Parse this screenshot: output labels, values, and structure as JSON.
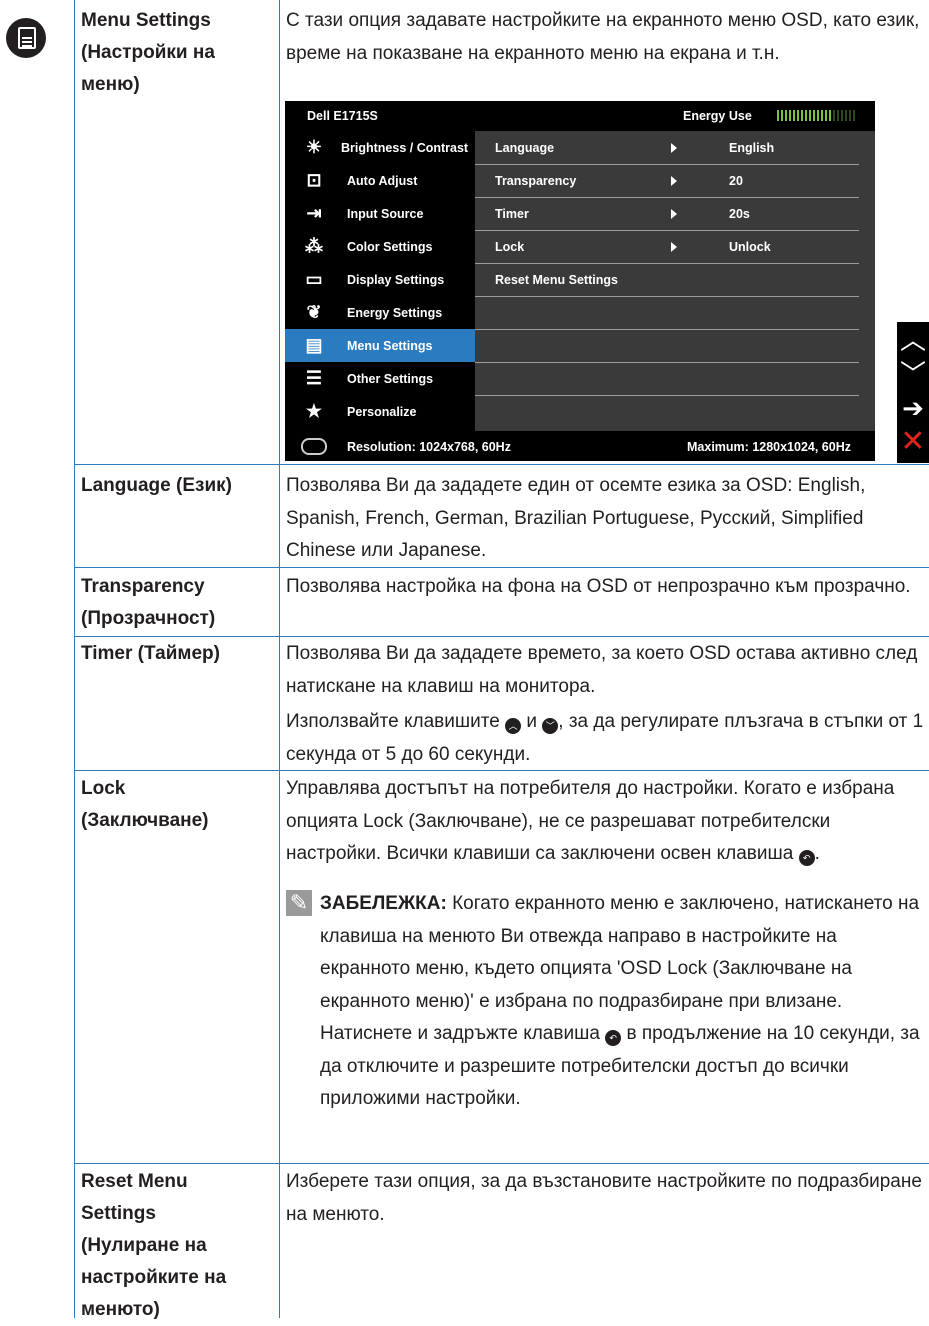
{
  "rows": {
    "menu_settings": {
      "label": "Menu Settings (Настройки на меню)",
      "desc": "С тази опция задавате настройките на екранното меню OSD, като език, време на показване на екранното меню на екрана и т.н."
    },
    "language": {
      "label": "Language (Език)",
      "desc": "Позволява Ви да зададете един от осемте езика за OSD: English, Spanish, French, German, Brazilian Portuguese, Русский, Simplified Chinese или Japanese."
    },
    "transparency": {
      "label": "Transparency (Прозрачност)",
      "desc": "Позволява настройка на фона на OSD от непрозрачно към прозрачно."
    },
    "timer": {
      "label": "Timer (Таймер)",
      "desc1": "Позволява Ви да зададете времето, за което OSD остава активно след натискане на клавиш на монитора.",
      "desc2_a": "Използвайте клавишите",
      "desc2_b": "и",
      "desc2_c": ", за да регулирате плъзгача в стъпки от 1 секунда от 5 до 60 секунди."
    },
    "lock": {
      "label": "Lock (Заключване)",
      "desc_a": "Управлява достъпът на потребителя до настройки. Когато е избрана опцията Lock (Заключване), не се разрешават потребителски настройки. Всички клавиши са заключени освен клавиша",
      "desc_b": ".",
      "note_label": "ЗАБЕЛЕЖКА:",
      "note_a": "Когато екранното меню е заключено, натискането на клавиша на менюто Ви отвежда направо в настройките на екранното меню, където опцията 'OSD Lock (Заключване на екранното меню)' е избрана по подразбиране при влизане. Натиснете и задръжте клавиша",
      "note_b": "в продължение на 10 секунди, за да отключите и разрешите потребителски достъп до всички приложими настройки."
    },
    "reset": {
      "label": "Reset Menu Settings (Нулиране на настройките на менюто)",
      "desc": "Изберете тази опция, за да възстановите настройките по подразбиране на менюто."
    }
  },
  "osd": {
    "model": "Dell E1715S",
    "energy_label": "Energy Use",
    "energy_level": 0.72,
    "menu": [
      {
        "icon": "sun-icon",
        "label": "Brightness / Contrast"
      },
      {
        "icon": "auto-adjust-icon",
        "label": "Auto Adjust"
      },
      {
        "icon": "input-source-icon",
        "label": "Input Source"
      },
      {
        "icon": "color-dots-icon",
        "label": "Color Settings"
      },
      {
        "icon": "display-icon",
        "label": "Display Settings"
      },
      {
        "icon": "leaf-icon",
        "label": "Energy Settings"
      },
      {
        "icon": "menu-icon",
        "label": "Menu Settings"
      },
      {
        "icon": "sliders-icon",
        "label": "Other Settings"
      },
      {
        "icon": "star-icon",
        "label": "Personalize"
      }
    ],
    "selected_index": 6,
    "items": [
      {
        "name": "Language",
        "value": "English",
        "arrow": true
      },
      {
        "name": "Transparency",
        "value": "20",
        "arrow": true
      },
      {
        "name": "Timer",
        "value": "20s",
        "arrow": true
      },
      {
        "name": "Lock",
        "value": "Unlock",
        "arrow": true
      },
      {
        "name": "Reset Menu Settings",
        "value": "",
        "arrow": false
      },
      {
        "name": "",
        "value": "",
        "arrow": false
      },
      {
        "name": "",
        "value": "",
        "arrow": false
      },
      {
        "name": "",
        "value": "",
        "arrow": false
      }
    ],
    "resolution": "Resolution: 1024x768, 60Hz",
    "maximum": "Maximum: 1280x1024, 60Hz"
  },
  "side_buttons": [
    "up-icon",
    "down-icon",
    "enter-icon",
    "exit-icon"
  ],
  "colors": {
    "accent": "#2b7bc0",
    "osd_bg": "#000000",
    "osd_panel": "#3a3a3a",
    "energy": "#7dc242",
    "exit": "#e2231a"
  }
}
